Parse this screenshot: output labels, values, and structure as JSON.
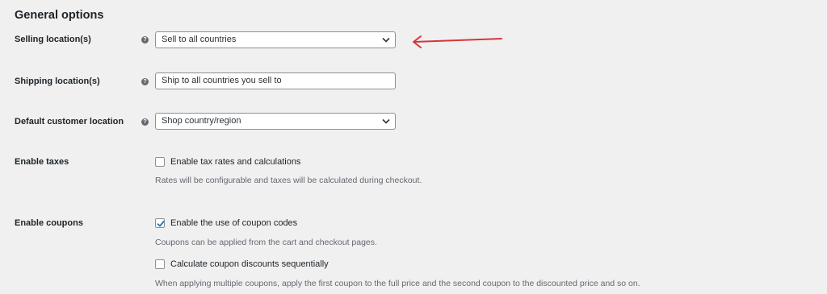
{
  "heading": "General options",
  "selling_location": {
    "label": "Selling location(s)",
    "value": "Sell to all countries"
  },
  "shipping_location": {
    "label": "Shipping location(s)",
    "value": "Ship to all countries you sell to"
  },
  "default_customer_location": {
    "label": "Default customer location",
    "value": "Shop country/region"
  },
  "enable_taxes": {
    "label": "Enable taxes",
    "checkbox_label": "Enable tax rates and calculations",
    "checked": false,
    "description": "Rates will be configurable and taxes will be calculated during checkout."
  },
  "enable_coupons": {
    "label": "Enable coupons",
    "checkbox_label": "Enable the use of coupon codes",
    "checked": true,
    "description": "Coupons can be applied from the cart and checkout pages.",
    "sequential": {
      "checkbox_label": "Calculate coupon discounts sequentially",
      "checked": false,
      "description": "When applying multiple coupons, apply the first coupon to the full price and the second coupon to the discounted price and so on."
    }
  },
  "help_icon_glyph": "?",
  "icons": {
    "help": "question-circle-icon",
    "dropdown": "chevron-down-icon",
    "checkmark": "checkmark-icon",
    "annotation": "red-arrow"
  },
  "colors": {
    "background": "#f0f0f1",
    "checkmark": "#2271b1",
    "annotation_arrow": "#d63638"
  }
}
